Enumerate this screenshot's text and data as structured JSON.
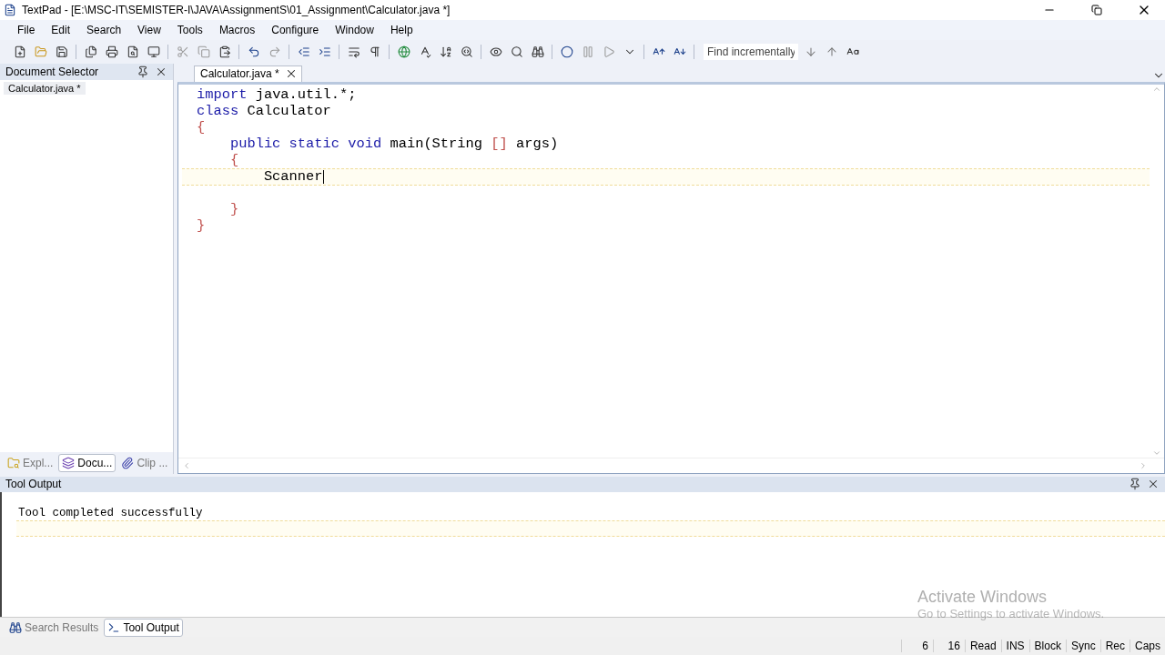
{
  "window": {
    "title": "TextPad - [E:\\MSC-IT\\SEMISTER-I\\JAVA\\AssignmentS\\01_Assignment\\Calculator.java *]"
  },
  "menu": [
    {
      "label": "File"
    },
    {
      "label": "Edit"
    },
    {
      "label": "Search"
    },
    {
      "label": "View"
    },
    {
      "label": "Tools"
    },
    {
      "label": "Macros"
    },
    {
      "label": "Configure"
    },
    {
      "label": "Window"
    },
    {
      "label": "Help"
    }
  ],
  "find": {
    "placeholder": "Find incrementally"
  },
  "document_selector": {
    "title": "Document Selector",
    "items": [
      {
        "label": "Calculator.java *",
        "selected": true
      }
    ],
    "tabs": [
      {
        "label": "Expl...",
        "selected": false
      },
      {
        "label": "Docu...",
        "selected": true
      },
      {
        "label": "Clip ...",
        "selected": false
      }
    ]
  },
  "editor": {
    "tabs": [
      {
        "label": "Calculator.java *",
        "selected": true
      }
    ],
    "lines": [
      {
        "current": false,
        "tokens": [
          {
            "kind": "keyword",
            "text": "import"
          },
          {
            "kind": "plain",
            "text": " java.util.*;"
          }
        ]
      },
      {
        "current": false,
        "tokens": [
          {
            "kind": "keyword",
            "text": "class"
          },
          {
            "kind": "plain",
            "text": " Calculator"
          }
        ]
      },
      {
        "current": false,
        "tokens": [
          {
            "kind": "bracket",
            "text": "{"
          }
        ]
      },
      {
        "current": false,
        "tokens": [
          {
            "kind": "keyword",
            "text": "    public static void"
          },
          {
            "kind": "plain",
            "text": " main(String "
          },
          {
            "kind": "bracket",
            "text": "[]"
          },
          {
            "kind": "plain",
            "text": " args)"
          }
        ]
      },
      {
        "current": false,
        "tokens": [
          {
            "kind": "bracket",
            "text": "    {"
          }
        ]
      },
      {
        "current": true,
        "tokens": [
          {
            "kind": "plain",
            "text": "        Scanner"
          }
        ]
      },
      {
        "current": false
      },
      {
        "current": false,
        "tokens": [
          {
            "kind": "bracket",
            "text": "    }"
          }
        ]
      },
      {
        "current": false,
        "tokens": [
          {
            "kind": "bracket",
            "text": "}"
          }
        ]
      }
    ]
  },
  "tool_output": {
    "title": "Tool Output",
    "lines": [
      {
        "text": "Tool completed successfully",
        "current": false
      },
      {
        "current": true
      }
    ],
    "tabs": [
      {
        "label": "Search Results",
        "selected": false
      },
      {
        "label": "Tool Output",
        "selected": true
      }
    ]
  },
  "status_bar": [
    "6",
    "16",
    "Read",
    "INS",
    "Block",
    "Sync",
    "Rec",
    "Caps"
  ],
  "overlay": {
    "title": "Activate Windows",
    "subtitle": "Go to Settings to activate Windows."
  }
}
